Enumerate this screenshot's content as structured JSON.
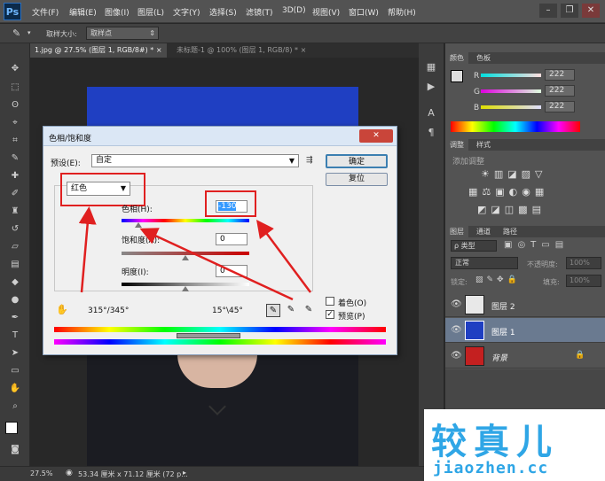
{
  "app": {
    "logo": "Ps"
  },
  "menu": [
    "文件(F)",
    "编辑(E)",
    "图像(I)",
    "图层(L)",
    "文字(Y)",
    "选择(S)",
    "滤镜(T)",
    "3D(D)",
    "视图(V)",
    "窗口(W)",
    "帮助(H)"
  ],
  "window_controls": {
    "minimize": "–",
    "restore": "❐",
    "close": "✕"
  },
  "options_bar": {
    "sample_size_label": "取样大小:",
    "sample_size_value": "取样点"
  },
  "doc_tabs": [
    {
      "label": "1.jpg @ 27.5% (图层 1, RGB/8#) *",
      "close": "×"
    },
    {
      "label": "未标题-1 @ 100% (图层 1, RGB/8) *",
      "close": "×"
    }
  ],
  "status": {
    "zoom": "27.5%",
    "doc_info": "53.34 厘米 x 71.12 厘米 (72 p..."
  },
  "color_panel": {
    "tabs": [
      "颜色",
      "色板"
    ],
    "r": {
      "label": "R",
      "value": "222"
    },
    "g": {
      "label": "G",
      "value": "222"
    },
    "b": {
      "label": "B",
      "value": "222"
    }
  },
  "adjust_panel": {
    "tabs": [
      "调整",
      "样式"
    ],
    "add_label": "添加调整"
  },
  "layers_panel": {
    "tabs": [
      "图层",
      "通道",
      "路径"
    ],
    "filter_label": "ρ 类型",
    "blend_mode": "正常",
    "opacity_label": "不透明度:",
    "opacity_value": "100%",
    "lock_label": "锁定:",
    "fill_label": "填充:",
    "fill_value": "100%",
    "layers": [
      {
        "name": "图层 2"
      },
      {
        "name": "图层 1"
      },
      {
        "name": "背景"
      }
    ]
  },
  "dialog": {
    "title": "色相/饱和度",
    "close": "✕",
    "preset_label": "预设(E):",
    "preset_value": "自定",
    "ok_label": "确定",
    "reset_label": "复位",
    "channel_value": "红色",
    "hue_label": "色相(H):",
    "hue_value": "-130",
    "saturation_label": "饱和度(A):",
    "saturation_value": "0",
    "lightness_label": "明度(I):",
    "lightness_value": "0",
    "range_left": "315°/345°",
    "range_right": "15°\\45°",
    "colorize_label": "着色(O)",
    "preview_label": "预览(P)",
    "hue_position": 0.13,
    "saturation_position": 0.5,
    "lightness_position": 0.5,
    "preview_checked": true,
    "colorize_checked": false
  },
  "watermark": {
    "title": "较真儿",
    "url": "jiaozhen.cc"
  },
  "colors": {
    "accent_red": "#e02020",
    "canvas_blue": "#1f3fc2",
    "ps_blue": "#6fb7ff"
  }
}
